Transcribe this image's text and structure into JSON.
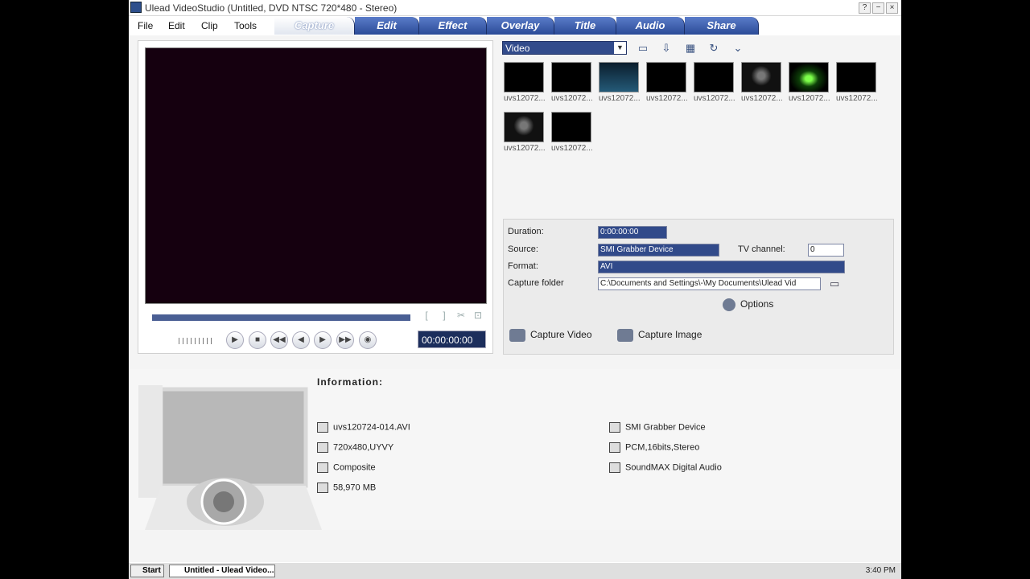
{
  "window": {
    "title": "Ulead VideoStudio (Untitled, DVD NTSC 720*480 - Stereo)",
    "help_label": "?",
    "minimize_label": "−",
    "close_label": "×"
  },
  "menu": {
    "items": [
      {
        "label": "File"
      },
      {
        "label": "Edit"
      },
      {
        "label": "Clip"
      },
      {
        "label": "Tools"
      }
    ]
  },
  "tabs": [
    {
      "label": "Capture",
      "active": true
    },
    {
      "label": "Edit"
    },
    {
      "label": "Effect"
    },
    {
      "label": "Overlay"
    },
    {
      "label": "Title"
    },
    {
      "label": "Audio"
    },
    {
      "label": "Share"
    }
  ],
  "preview": {
    "mark_in_label": "[",
    "mark_out_label": "]",
    "cut_label": "✂",
    "fullscreen_label": "⊡",
    "timecode": "00:00:00:00",
    "controls": [
      "play-icon",
      "stop-icon",
      "rewind-icon",
      "previous-frame-icon",
      "next-frame-icon",
      "forward-icon",
      "volume-icon"
    ]
  },
  "library": {
    "category": "Video",
    "thumbnails": [
      {
        "label": "uvs12072...",
        "type": "black"
      },
      {
        "label": "uvs12072...",
        "type": "black"
      },
      {
        "label": "uvs12072...",
        "type": "blue"
      },
      {
        "label": "uvs12072...",
        "type": "black"
      },
      {
        "label": "uvs12072...",
        "type": "black"
      },
      {
        "label": "uvs12072...",
        "type": "cod"
      },
      {
        "label": "uvs12072...",
        "type": "green"
      },
      {
        "label": "uvs12072...",
        "type": "black"
      },
      {
        "label": "uvs12072...",
        "type": "cod"
      },
      {
        "label": "uvs12072...",
        "type": "black"
      }
    ]
  },
  "capture": {
    "duration_label": "Duration:",
    "duration_value": "0:00:00:00",
    "source_label": "Source:",
    "source_value": "SMI Grabber Device",
    "tv_channel_label": "TV channel:",
    "tv_channel_value": "0",
    "format_label": "Format:",
    "format_value": "AVI",
    "folder_label": "Capture folder",
    "folder_value": "C:\\Documents and Settings\\-\\My Documents\\Ulead Vid",
    "options_label": "Options",
    "capture_video_label": "Capture Video",
    "capture_image_label": "Capture Image"
  },
  "info": {
    "title": "Information:",
    "left": [
      {
        "icon": "film-icon",
        "text": "uvs120724-014.AVI"
      },
      {
        "icon": "video-format-icon",
        "text": "720x480,UYVY"
      },
      {
        "icon": "checkbox-icon",
        "text": "Composite"
      },
      {
        "icon": "disk-space-icon",
        "text": "58,970 MB"
      }
    ],
    "right": [
      {
        "icon": "monitor-icon",
        "text": "SMI Grabber Device"
      },
      {
        "icon": "music-note-icon",
        "text": "PCM,16bits,Stereo"
      },
      {
        "icon": "audio-device-icon",
        "text": "SoundMAX Digital Audio"
      }
    ]
  },
  "taskbar": {
    "start": "Start",
    "active_task": "Untitled - Ulead Video...",
    "time": "3:40 PM"
  }
}
